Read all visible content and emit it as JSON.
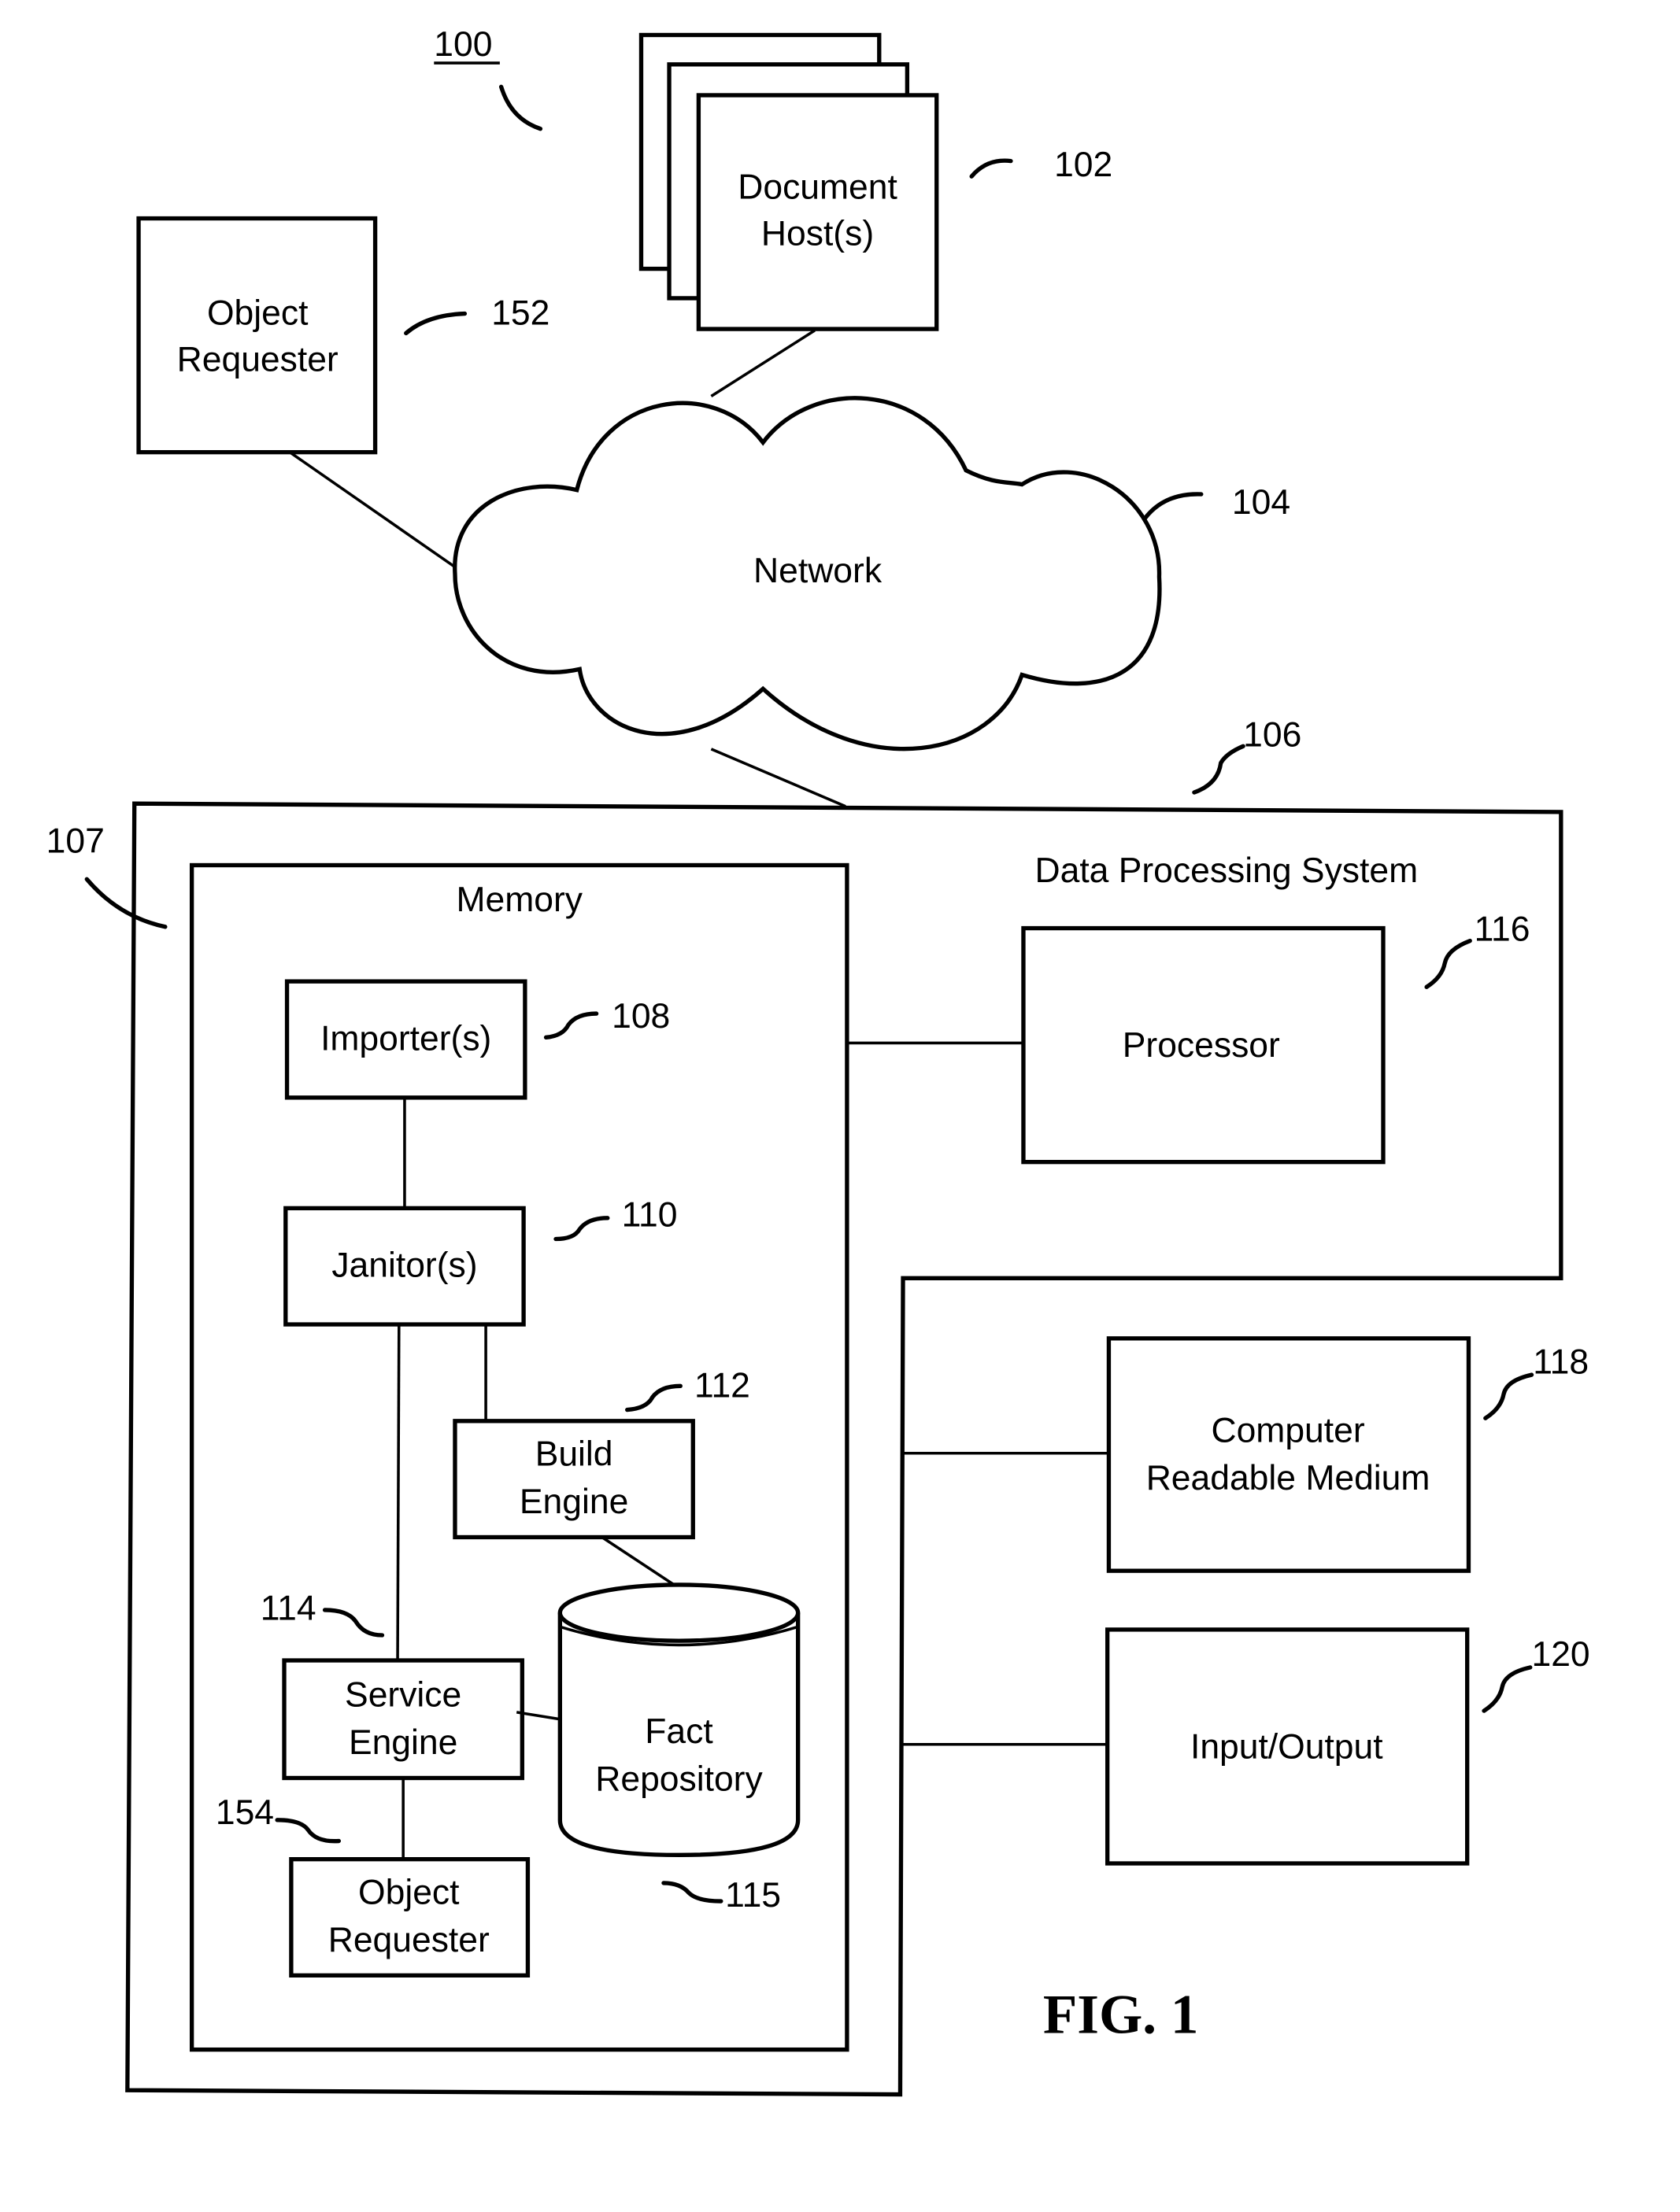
{
  "figure": {
    "system_ref": "100",
    "caption": "FIG. 1"
  },
  "document_hosts": {
    "label_line1": "Document",
    "label_line2": "Host(s)",
    "ref": "102"
  },
  "object_requester_external": {
    "label_line1": "Object",
    "label_line2": "Requester",
    "ref": "152"
  },
  "network": {
    "label": "Network",
    "ref": "104"
  },
  "data_processing_system": {
    "label": "Data Processing System",
    "ref": "106",
    "outer_ref": "107"
  },
  "memory": {
    "label": "Memory"
  },
  "importers": {
    "label": "Importer(s)",
    "ref": "108"
  },
  "janitors": {
    "label": "Janitor(s)",
    "ref": "110"
  },
  "build_engine": {
    "label_line1": "Build",
    "label_line2": "Engine",
    "ref": "112"
  },
  "service_engine": {
    "label_line1": "Service",
    "label_line2": "Engine",
    "ref": "114"
  },
  "fact_repository": {
    "label_line1": "Fact",
    "label_line2": "Repository",
    "ref": "115"
  },
  "object_requester_internal": {
    "label_line1": "Object",
    "label_line2": "Requester",
    "ref": "154"
  },
  "processor": {
    "label": "Processor",
    "ref": "116"
  },
  "computer_readable_medium": {
    "label_line1": "Computer",
    "label_line2": "Readable Medium",
    "ref": "118"
  },
  "input_output": {
    "label": "Input/Output",
    "ref": "120"
  }
}
